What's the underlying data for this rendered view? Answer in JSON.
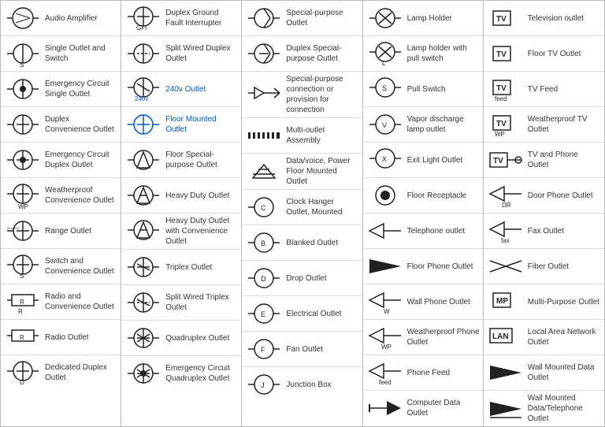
{
  "columns": [
    {
      "rows": [
        {
          "symbol": "audio-amplifier",
          "label": "Audio Amplifier"
        },
        {
          "symbol": "single-outlet-switch",
          "label": "Single Outlet and Switch",
          "sub": "S"
        },
        {
          "symbol": "emergency-circuit-single",
          "label": "Emergency Circuit Single Outlet"
        },
        {
          "symbol": "duplex-convenience",
          "label": "Duplex Convenience Outlet"
        },
        {
          "symbol": "emergency-circuit-duplex",
          "label": "Emergency Circuit Duplex Outlet"
        },
        {
          "symbol": "weatherproof-convenience",
          "label": "Weatherproof Convenience Outlet",
          "sub": "WP"
        },
        {
          "symbol": "range-outlet",
          "label": "Range Outlet"
        },
        {
          "symbol": "switch-convenience",
          "label": "Switch and Convenience Outlet",
          "sub": "S"
        },
        {
          "symbol": "radio-convenience",
          "label": "Radio and Convenience Outlet",
          "sub": "R"
        },
        {
          "symbol": "radio-outlet",
          "label": "Radio Outlet",
          "sub": "R"
        },
        {
          "symbol": "dedicated-duplex",
          "label": "Dedicated Duplex Outlet",
          "sub": "D"
        }
      ]
    },
    {
      "rows": [
        {
          "symbol": "duplex-ground-fault",
          "label": "Duplex Ground Fault Interrupter",
          "sub": "GFI"
        },
        {
          "symbol": "split-wired-duplex",
          "label": "Split Wired Duplex Outlet"
        },
        {
          "symbol": "240v-outlet",
          "label": "240v Outlet",
          "sub": "240v",
          "label_blue": true
        },
        {
          "symbol": "floor-mounted-outlet",
          "label": "Floor Mounted Outlet",
          "label_blue": true
        },
        {
          "symbol": "floor-special-purpose",
          "label": "Floor Special-purpose Outlet"
        },
        {
          "symbol": "heavy-duty-outlet",
          "label": "Heavy Duty Outlet"
        },
        {
          "symbol": "heavy-duty-convenience",
          "label": "Heavy Duty Outlet with Convenience Outlet"
        },
        {
          "symbol": "triplex-outlet",
          "label": "Triplex Outlet"
        },
        {
          "symbol": "split-wired-triplex",
          "label": "Split Wired Triplex Outlet"
        },
        {
          "symbol": "quadruplex-outlet",
          "label": "Quadruplex Outlet"
        },
        {
          "symbol": "emergency-circuit-quadruplex",
          "label": "Emergency Circuit Quadruplex Outlet"
        }
      ]
    },
    {
      "rows": [
        {
          "symbol": "special-purpose",
          "label": "Special-purpose Outlet"
        },
        {
          "symbol": "duplex-special-purpose",
          "label": "Duplex Special-purpose Outlet"
        },
        {
          "symbol": "special-purpose-connection",
          "label": "Special-purpose connection or provision for connection"
        },
        {
          "symbol": "multi-outlet-assembly",
          "label": "Multi-outlet Assembly"
        },
        {
          "symbol": "data-voice-floor",
          "label": "Data/voice, Power Floor Mounted Outlet"
        },
        {
          "symbol": "clock-hanger",
          "label": "Clock Hanger Outlet, Mounted"
        },
        {
          "symbol": "blanked-outlet",
          "label": "Blanked Outlet",
          "sub": "B"
        },
        {
          "symbol": "drop-outlet",
          "label": "Drop Outlet",
          "sub": "D"
        },
        {
          "symbol": "electrical-outlet",
          "label": "Electrical Outlet",
          "sub": "E"
        },
        {
          "symbol": "fan-outlet",
          "label": "Fan Outlet",
          "sub": "F"
        },
        {
          "symbol": "junction-box",
          "label": "Junction Box",
          "sub": "J"
        }
      ]
    },
    {
      "rows": [
        {
          "symbol": "lamp-holder",
          "label": "Lamp Holder"
        },
        {
          "symbol": "lamp-holder-pull",
          "label": "Lamp holder with pull switch",
          "sub": "L"
        },
        {
          "symbol": "pull-switch",
          "label": "Pull Switch",
          "sub": "S"
        },
        {
          "symbol": "vapor-discharge",
          "label": "Vapor discharge lamp outlet",
          "sub": "V"
        },
        {
          "symbol": "exit-light",
          "label": "Exit Light Outlet",
          "sub": "X"
        },
        {
          "symbol": "floor-receptacle",
          "label": "Floor Receptacle"
        },
        {
          "symbol": "telephone-outlet",
          "label": "Telephone outlet"
        },
        {
          "symbol": "floor-phone",
          "label": "Floor Phone Outlet"
        },
        {
          "symbol": "wall-phone",
          "label": "Wall Phone Outlet",
          "sub": "W"
        },
        {
          "symbol": "weatherproof-phone",
          "label": "Weatherproof Phone Outlet",
          "sub": "WP"
        },
        {
          "symbol": "phone-feed",
          "label": "Phone Feed",
          "sub": "feed"
        },
        {
          "symbol": "computer-data",
          "label": "Computer Data Outlet"
        }
      ]
    },
    {
      "rows": [
        {
          "symbol": "television-outlet",
          "label": "Television outlet",
          "tv": true
        },
        {
          "symbol": "floor-tv",
          "label": "Floor TV Outlet",
          "tv": true
        },
        {
          "symbol": "tv-feed",
          "label": "TV Feed",
          "tv": true,
          "sub": "feed"
        },
        {
          "symbol": "weatherproof-tv",
          "label": "Weatherproof TV Outlet",
          "tv": true,
          "sub": "WP"
        },
        {
          "symbol": "tv-phone",
          "label": "TV and Phone Outlet",
          "tv": true
        },
        {
          "symbol": "door-phone",
          "label": "Door Phone Outlet",
          "sub": "DR"
        },
        {
          "symbol": "fax-outlet",
          "label": "Fax Outlet",
          "sub": "fax"
        },
        {
          "symbol": "fiber-outlet",
          "label": "Fiber Outlet"
        },
        {
          "symbol": "multi-purpose",
          "label": "Multi-Purpose Outlet",
          "sub": "MP"
        },
        {
          "symbol": "lan-outlet",
          "label": "Local Area Network Outlet",
          "sub": "LAN"
        },
        {
          "symbol": "wall-data",
          "label": "Wall Mounted Data Outlet"
        },
        {
          "symbol": "wall-data-telephone",
          "label": "Wall Mounted Data/Telephone Outlet"
        }
      ]
    }
  ]
}
